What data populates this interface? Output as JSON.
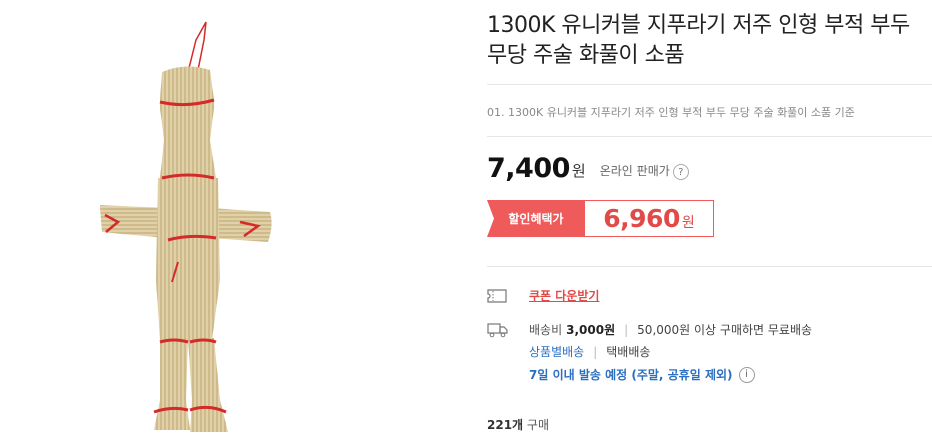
{
  "product": {
    "title_line1": "1300K 유니커블 지푸라기 저주 인형 부적 부두",
    "title_line2": "무당 주술 화풀이 소품",
    "sub_text": "01. 1300K 유니커블 지푸라기 저주 인형 부적 부두 무당 주술 화풀이 소품 기준",
    "image_alt": "straw doll"
  },
  "price": {
    "amount": "7,400",
    "unit": "원",
    "note": "온라인 판매가",
    "help_glyph": "?"
  },
  "discount": {
    "label": "할인혜택가",
    "amount": "6,960",
    "unit": "원"
  },
  "coupon": {
    "label": "쿠폰 다운받기",
    "icon": "coupon-icon"
  },
  "shipping": {
    "icon": "truck-icon",
    "fee_label": "배송비",
    "fee_value": "3,000원",
    "condition": "50,000원 이상 구매하면 무료배송",
    "method_label": "상품별배송",
    "method_value": "택배배송",
    "schedule": "7일 이내 발송 예정 (주말, 공휴일 제외)",
    "info_glyph": "i"
  },
  "sales": {
    "count": "221개",
    "label": "구매"
  },
  "colors": {
    "accent_red": "#ef5a5a",
    "link_blue": "#2b6fc2",
    "straw": "#d8c79a",
    "string_red": "#d42a2a"
  }
}
